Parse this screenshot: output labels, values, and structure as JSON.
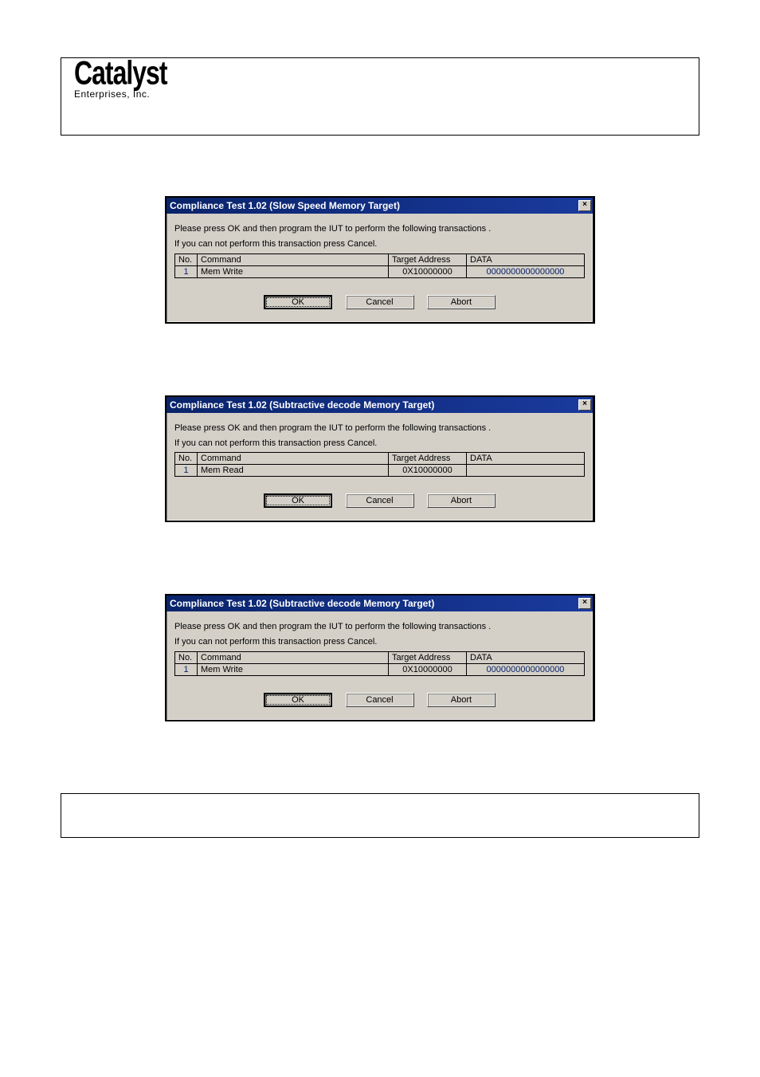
{
  "brand": {
    "name": "Catalyst",
    "sub": "Enterprises, Inc."
  },
  "dialogs": [
    {
      "title": "Compliance Test 1.02 (Slow Speed Memory Target)",
      "close_glyph": "×",
      "line1": "Please press OK and then program the IUT to perform the following transactions .",
      "line2": "If you can not perform this transaction press Cancel.",
      "headers": {
        "no": "No.",
        "command": "Command",
        "target": "Target Address",
        "data": "DATA"
      },
      "rows": [
        {
          "no": "1",
          "command": "Mem Write",
          "target": "0X10000000",
          "data": "0000000000000000"
        }
      ],
      "buttons": {
        "ok": "OK",
        "cancel": "Cancel",
        "abort": "Abort"
      }
    },
    {
      "title": "Compliance Test 1.02 (Subtractive decode Memory Target)",
      "close_glyph": "×",
      "line1": "Please press OK and then program the IUT to perform the following transactions .",
      "line2": "If you can not perform this transaction press Cancel.",
      "headers": {
        "no": "No.",
        "command": "Command",
        "target": "Target Address",
        "data": "DATA"
      },
      "rows": [
        {
          "no": "1",
          "command": "Mem Read",
          "target": "0X10000000",
          "data": ""
        }
      ],
      "buttons": {
        "ok": "OK",
        "cancel": "Cancel",
        "abort": "Abort"
      }
    },
    {
      "title": "Compliance Test 1.02 (Subtractive decode Memory Target)",
      "close_glyph": "×",
      "line1": "Please press OK and then program the IUT to perform the following transactions .",
      "line2": "If you can not perform this transaction press Cancel.",
      "headers": {
        "no": "No.",
        "command": "Command",
        "target": "Target Address",
        "data": "DATA"
      },
      "rows": [
        {
          "no": "1",
          "command": "Mem Write",
          "target": "0X10000000",
          "data": "0000000000000000"
        }
      ],
      "buttons": {
        "ok": "OK",
        "cancel": "Cancel",
        "abort": "Abort"
      }
    }
  ]
}
